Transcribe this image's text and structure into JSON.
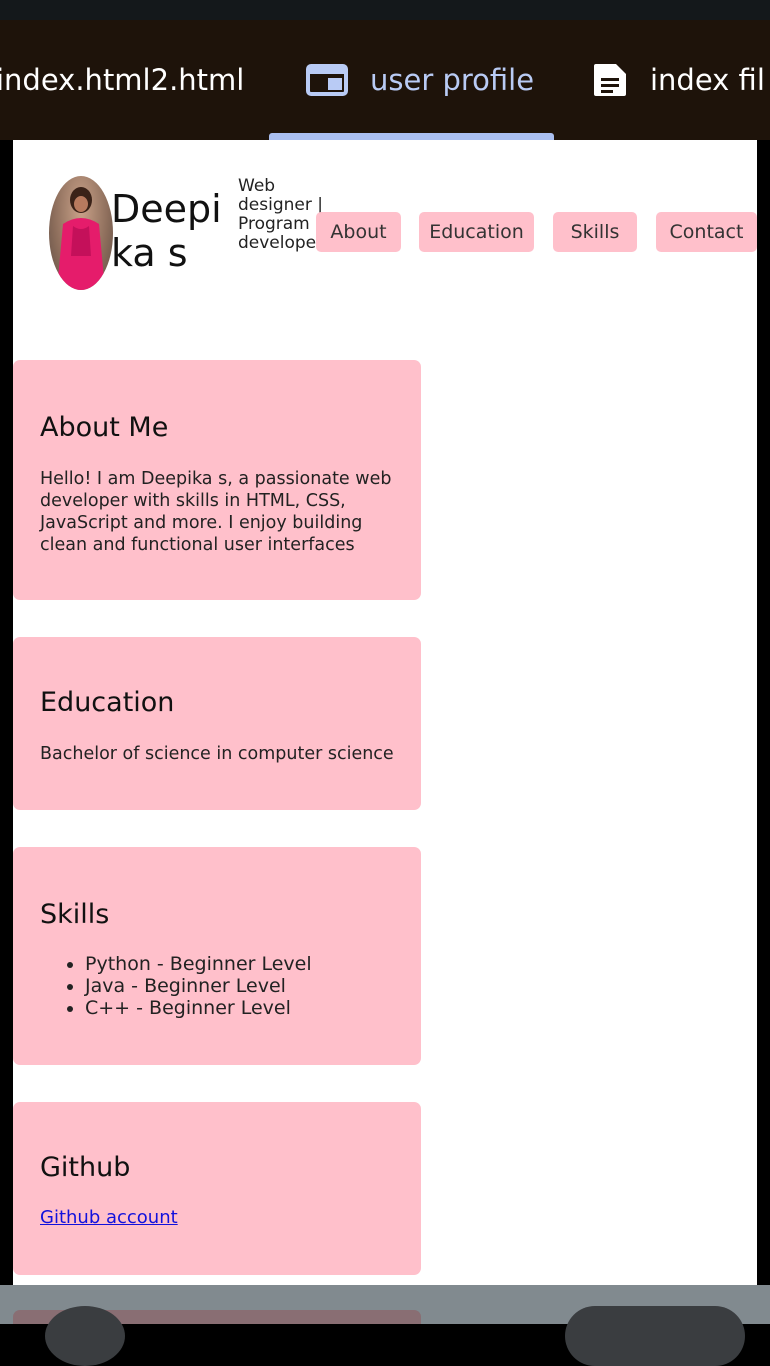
{
  "tabs": [
    {
      "label": "index.html2.html",
      "icon": "none"
    },
    {
      "label": "user profile",
      "icon": "browser-window-icon",
      "active": true
    },
    {
      "label": "index fil",
      "icon": "document-icon"
    }
  ],
  "profile": {
    "name": "Deepika s",
    "subtitle": "Web designer | Program developer"
  },
  "nav": [
    "About",
    "Education",
    "Skills",
    "Contact"
  ],
  "about": {
    "title": "About Me",
    "text": "Hello! I am Deepika s, a passionate web developer with skills in HTML, CSS, JavaScript and more. I enjoy building clean and functional user interfaces"
  },
  "education": {
    "title": "Education",
    "text": "Bachelor of science in computer science"
  },
  "skills": {
    "title": "Skills",
    "items": [
      "Python - Beginner Level",
      "Java - Beginner Level",
      "C++ - Beginner Level"
    ]
  },
  "github": {
    "title": "Github",
    "link": "Github account"
  },
  "colors": {
    "card_bg": "#ffc0cb",
    "tabbar_bg": "#1e130a",
    "active_tab": "#b9cbf5",
    "link": "#1111dd"
  }
}
